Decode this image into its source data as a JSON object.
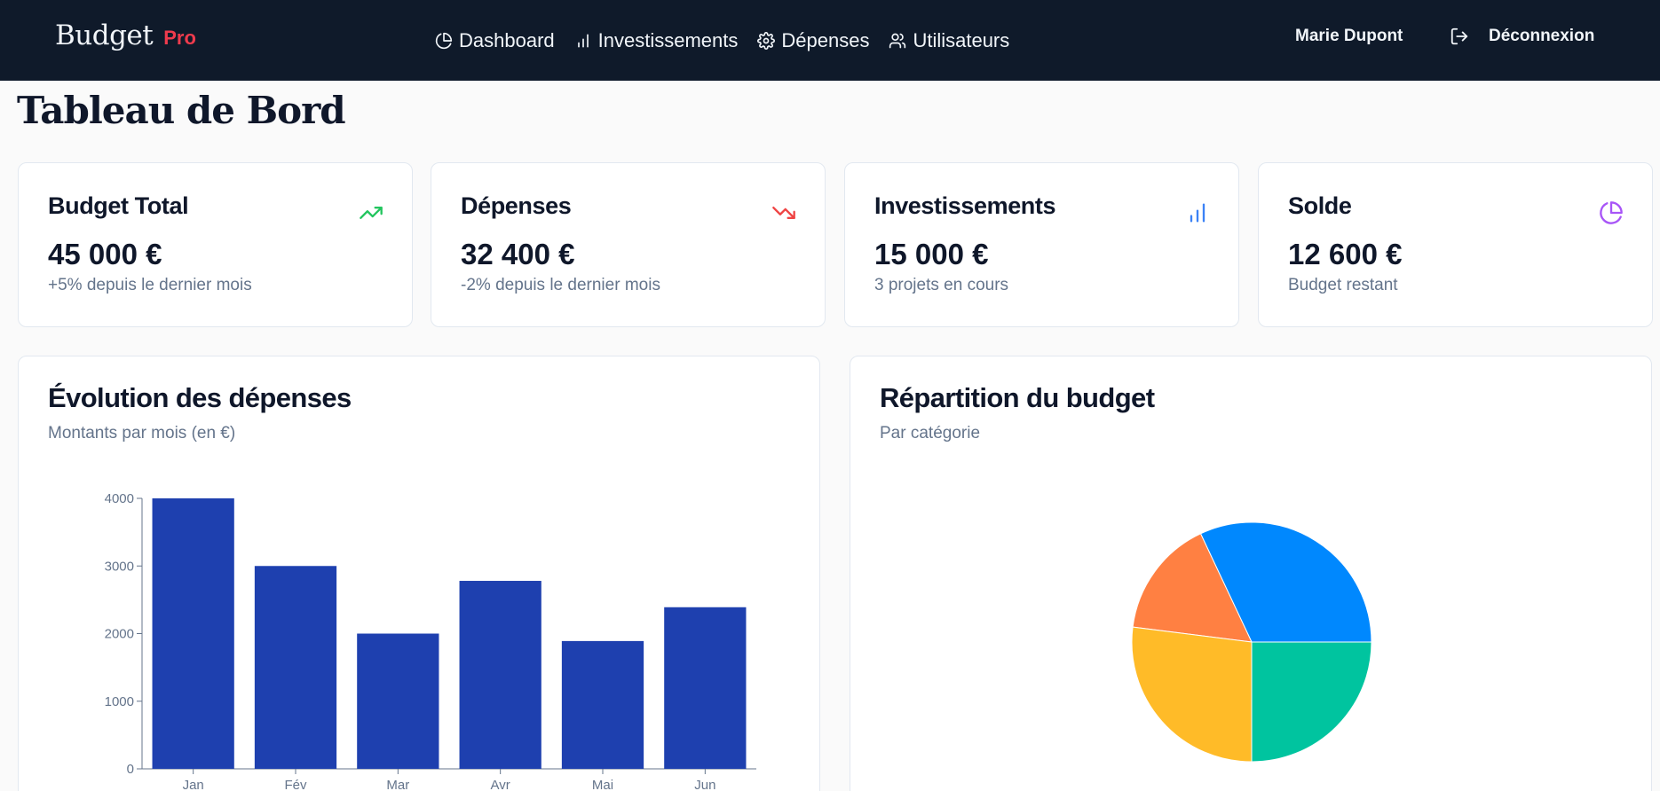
{
  "nav": {
    "brand": "Budget",
    "brand_badge": "Pro",
    "links": [
      {
        "label": "Dashboard",
        "icon": "pie-chart-icon"
      },
      {
        "label": "Investissements",
        "icon": "bar-chart-icon"
      },
      {
        "label": "Dépenses",
        "icon": "gear-icon"
      },
      {
        "label": "Utilisateurs",
        "icon": "users-icon"
      }
    ],
    "user": "Marie Dupont",
    "logout": "Déconnexion"
  },
  "page": {
    "title": "Tableau de Bord"
  },
  "stats": [
    {
      "title": "Budget Total",
      "value": "45 000 €",
      "sub": "+5% depuis le dernier mois",
      "icon": "trending-up-icon",
      "color": "#22c55e"
    },
    {
      "title": "Dépenses",
      "value": "32 400 €",
      "sub": "-2% depuis le dernier mois",
      "icon": "trending-down-icon",
      "color": "#ef4444"
    },
    {
      "title": "Investissements",
      "value": "15 000 €",
      "sub": "3 projets en cours",
      "icon": "bar-chart-icon",
      "color": "#3b82f6"
    },
    {
      "title": "Solde",
      "value": "12 600 €",
      "sub": "Budget restant",
      "icon": "pie-chart-icon",
      "color": "#a855f7"
    }
  ],
  "expenses_panel": {
    "title": "Évolution des dépenses",
    "subtitle": "Montants par mois (en €)"
  },
  "budget_panel": {
    "title": "Répartition du budget",
    "subtitle": "Par catégorie"
  },
  "colors": {
    "nav_bg": "#0f1a2a",
    "bar": "#1e40af",
    "brand_badge": "#ef3b4d"
  },
  "chart_data": [
    {
      "type": "bar",
      "categories": [
        "Jan",
        "Fév",
        "Mar",
        "Avr",
        "Mai",
        "Jun"
      ],
      "values": [
        4000,
        3000,
        2000,
        2780,
        1890,
        2390
      ],
      "ylim": [
        0,
        4000
      ],
      "yticks": [
        0,
        1000,
        2000,
        3000,
        4000
      ],
      "color": "#1e40af"
    },
    {
      "type": "pie",
      "values": [
        32,
        16,
        27,
        25
      ],
      "colors": [
        "#0088fe",
        "#ff8042",
        "#ffbb28",
        "#00c49f"
      ]
    }
  ]
}
